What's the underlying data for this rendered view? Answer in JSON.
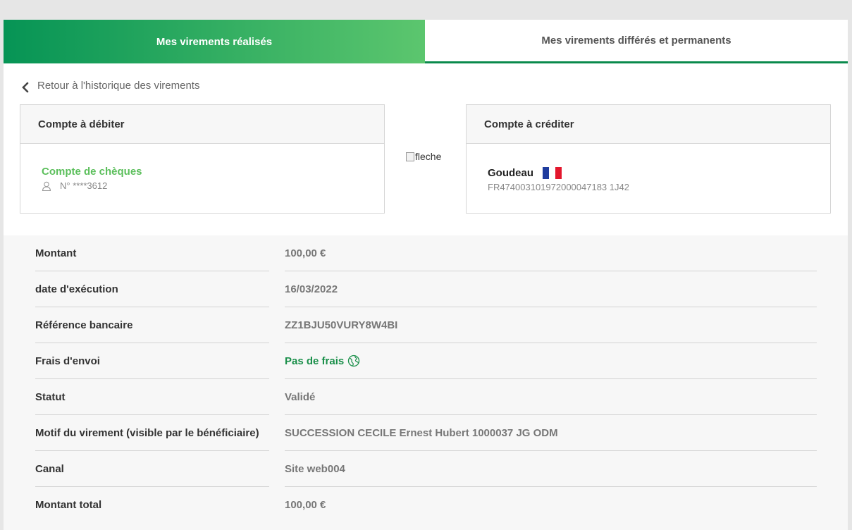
{
  "tabs": {
    "done": "Mes virements réalisés",
    "scheduled": "Mes virements différés et permanents"
  },
  "back_link": "Retour à l'historique des virements",
  "debit": {
    "header": "Compte à débiter",
    "account_name": "Compte de chèques",
    "account_number": "N° ****3612"
  },
  "arrow_alt": "fleche",
  "credit": {
    "header": "Compte à créditer",
    "beneficiary": "Goudeau",
    "iban": "FR474003101972000047183 1J42"
  },
  "details": [
    {
      "label": "Montant",
      "value": "100,00 €"
    },
    {
      "label": "date d'exécution",
      "value": "16/03/2022"
    },
    {
      "label": "Référence bancaire",
      "value": "ZZ1BJU50VURY8W4BI"
    },
    {
      "label": "Frais d'envoi",
      "value": "Pas de frais"
    },
    {
      "label": "Statut",
      "value": "Validé"
    },
    {
      "label": "Motif du virement (visible par le bénéficiaire)",
      "value": "SUCCESSION CECILE Ernest Hubert 1000037 JG ODM"
    },
    {
      "label": "Canal",
      "value": "Site web004"
    },
    {
      "label": "Montant total",
      "value": "100,00 €"
    }
  ],
  "colors": {
    "brand_green": "#069455",
    "light_green": "#5cc66e",
    "flag_blue": "#1f3c9e",
    "flag_red": "#e3172d"
  },
  "icons": {
    "back": "chevron-left-icon",
    "user": "user-icon",
    "fees": "globe-icon"
  }
}
